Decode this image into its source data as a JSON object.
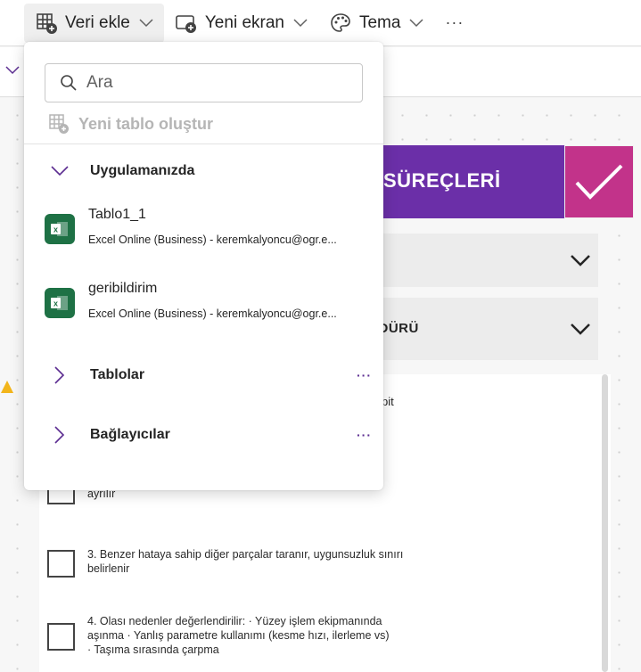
{
  "toolbar": {
    "add_data_label": "Veri ekle",
    "new_screen_label": "Yeni ekran",
    "theme_label": "Tema",
    "more_label": "···"
  },
  "dropdown": {
    "search_placeholder": "Ara",
    "new_table_label": "Yeni tablo oluştur",
    "section_in_app": "Uygulamanızda",
    "data_sources": [
      {
        "name": "Tablo1_1",
        "subtitle": "Excel Online (Business) - keremkalyoncu@ogr.e..."
      },
      {
        "name": "geribildirim",
        "subtitle": "Excel Online (Business) - keremkalyoncu@ogr.e..."
      }
    ],
    "section_tables": "Tablolar",
    "section_connectors": "Bağlayıcılar",
    "more_label": "···"
  },
  "canvas": {
    "header_title": "SÜREÇLERİ",
    "accordion2_label": "EDÜRÜ",
    "bit_text": "pit",
    "partial_step_text": "ayrılır",
    "steps": [
      {
        "text": "3. Benzer hataya sahip diğer parçalar taranır, uygunsuzluk sınırı belirlenir"
      },
      {
        "text": "4. Olası nedenler değerlendirilir: · Yüzey işlem ekipmanında aşınma · Yanlış parametre kullanımı (kesme hızı, ilerleme vs) · Taşıma sırasında çarpma"
      }
    ]
  },
  "colors": {
    "header_purple": "#6b2fa8",
    "check_magenta": "#c2338a",
    "excel_green": "#1e7145",
    "accent_purple": "#5c2d91"
  }
}
